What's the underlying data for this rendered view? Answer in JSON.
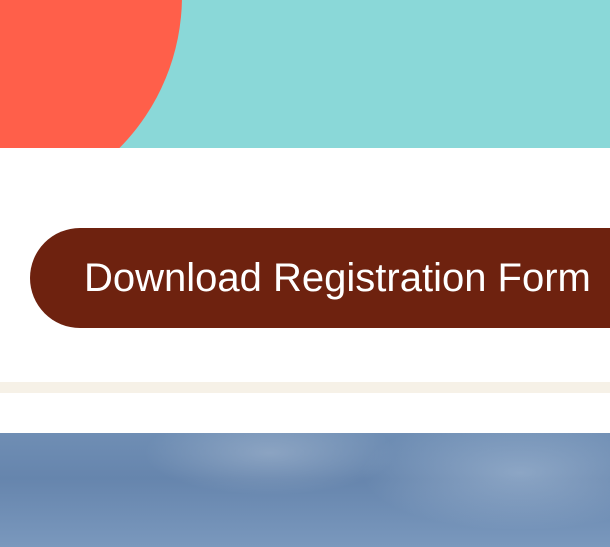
{
  "hero": {
    "background_color": "#8ad8d8",
    "circle_color": "#ff5f4a"
  },
  "cta": {
    "label": "Download Registration Form",
    "background_color": "#6e220f",
    "text_color": "#ffffff"
  },
  "divider": {
    "color": "#f6f1e7"
  },
  "photo": {
    "primary_color": "#6f8eb4"
  }
}
